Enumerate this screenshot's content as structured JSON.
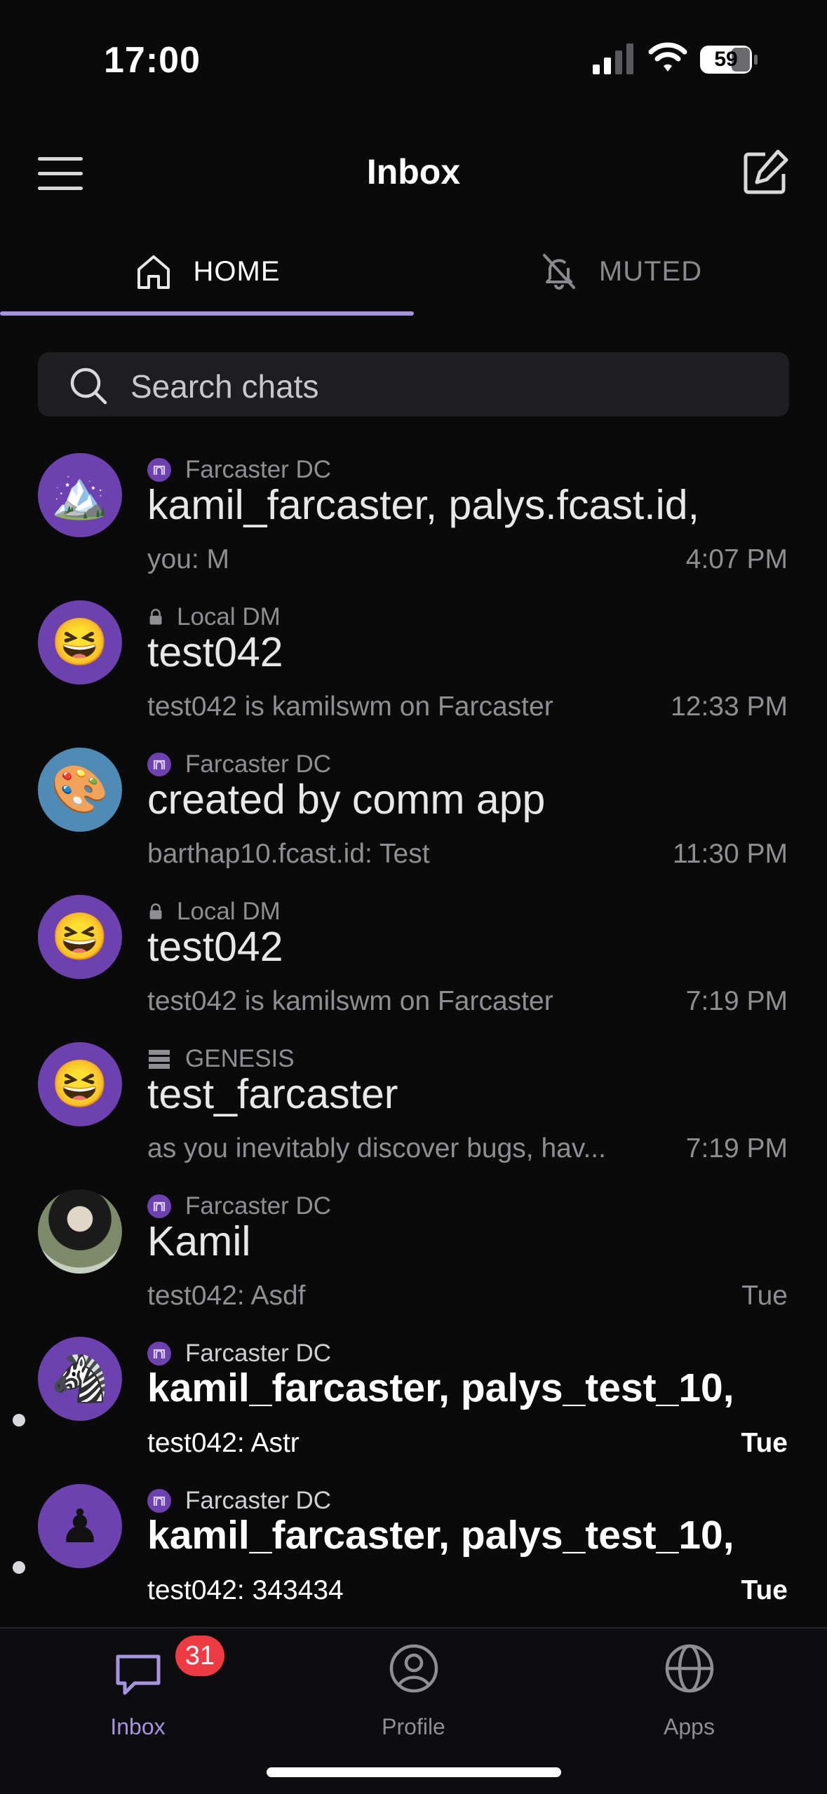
{
  "status_bar": {
    "time": "17:00",
    "battery": "59"
  },
  "header": {
    "title": "Inbox"
  },
  "tabs": [
    {
      "label": "HOME",
      "icon": "home-icon",
      "active": true
    },
    {
      "label": "MUTED",
      "icon": "bell-off-icon",
      "active": false
    }
  ],
  "search": {
    "placeholder": "Search chats"
  },
  "chats": [
    {
      "badge": "Farcaster DC",
      "badge_icon": "farcaster-icon",
      "title": "kamil_farcaster, palys.fcast.id,",
      "preview": "you: M",
      "time": "4:07 PM",
      "avatar": "🏔️",
      "unread": false
    },
    {
      "badge": "Local DM",
      "badge_icon": "lock-icon",
      "title": "test042",
      "preview": "test042 is kamilswm on Farcaster",
      "time": "12:33 PM",
      "avatar": "😆",
      "unread": false
    },
    {
      "badge": "Farcaster DC",
      "badge_icon": "farcaster-icon",
      "title": "created by comm app",
      "preview": "barthap10.fcast.id: Test",
      "time": "11:30 PM",
      "avatar": "🎨",
      "unread": false
    },
    {
      "badge": "Local DM",
      "badge_icon": "lock-icon",
      "title": "test042",
      "preview": "test042 is kamilswm on Farcaster",
      "time": "7:19 PM",
      "avatar": "😆",
      "unread": false
    },
    {
      "badge": "GENESIS",
      "badge_icon": "server-icon",
      "title": "test_farcaster",
      "preview": "as you inevitably discover bugs, hav...",
      "time": "7:19 PM",
      "avatar": "😆",
      "unread": false
    },
    {
      "badge": "Farcaster DC",
      "badge_icon": "farcaster-icon",
      "title": "Kamil",
      "preview": "test042: Asdf",
      "time": "Tue",
      "avatar": "",
      "unread": false
    },
    {
      "badge": "Farcaster DC",
      "badge_icon": "farcaster-icon",
      "title": "kamil_farcaster, palys_test_10,",
      "preview": "test042: Astr",
      "time": "Tue",
      "avatar": "🦓",
      "unread": true
    },
    {
      "badge": "Farcaster DC",
      "badge_icon": "farcaster-icon",
      "title": "kamil_farcaster, palys_test_10,",
      "preview": "test042: 343434",
      "time": "Tue",
      "avatar": "♟",
      "unread": true
    }
  ],
  "tab_bar": {
    "inbox": {
      "label": "Inbox",
      "badge": "31"
    },
    "profile": {
      "label": "Profile"
    },
    "apps": {
      "label": "Apps"
    }
  },
  "colors": {
    "accent": "#a694e0",
    "avatar_bg": "#6d42b0",
    "badge_red": "#ee3b43",
    "background": "#0a0a0b"
  }
}
